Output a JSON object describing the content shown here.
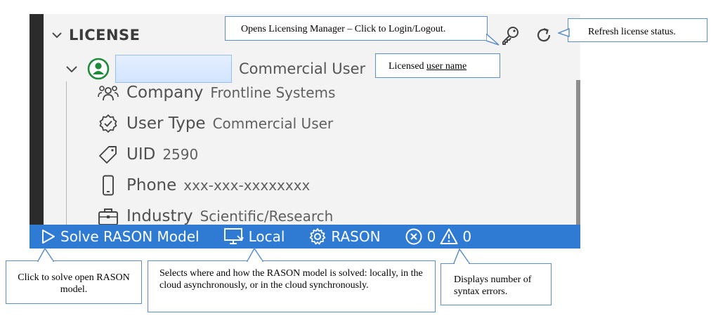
{
  "license": {
    "section_title": "LICENSE",
    "user_role": "Commercial User",
    "details": [
      {
        "icon": "people-icon",
        "label": "Company",
        "value": "Frontline Systems"
      },
      {
        "icon": "verified-badge-icon",
        "label": "User Type",
        "value": "Commercial User"
      },
      {
        "icon": "tag-icon",
        "label": "UID",
        "value": "2590"
      },
      {
        "icon": "phone-icon",
        "label": "Phone",
        "value": "xxx-xxx-xxxxxxxx"
      },
      {
        "icon": "briefcase-icon",
        "label": "Industry",
        "value": "Scientific/Research"
      }
    ]
  },
  "statusbar": {
    "solve_label": "Solve RASON Model",
    "location_label": "Local",
    "settings_label": "RASON",
    "error_count": "0",
    "warning_count": "0"
  },
  "callouts": {
    "licensing_manager": "Opens Licensing Manager – Click to Login/Logout.",
    "refresh": "Refresh license status.",
    "licensed_prefix": "Licensed ",
    "licensed_link": "user name",
    "solve": "Click to solve open RASON model.",
    "location": "Selects where and how the RASON model is solved: locally, in the cloud asynchronously, or in the cloud synchronously.",
    "errors": "Displays number of syntax errors."
  },
  "colors": {
    "statusbar": "#2f7ad3",
    "callout_border": "#5b8fc9",
    "avatar_green": "#1e8a3a"
  }
}
